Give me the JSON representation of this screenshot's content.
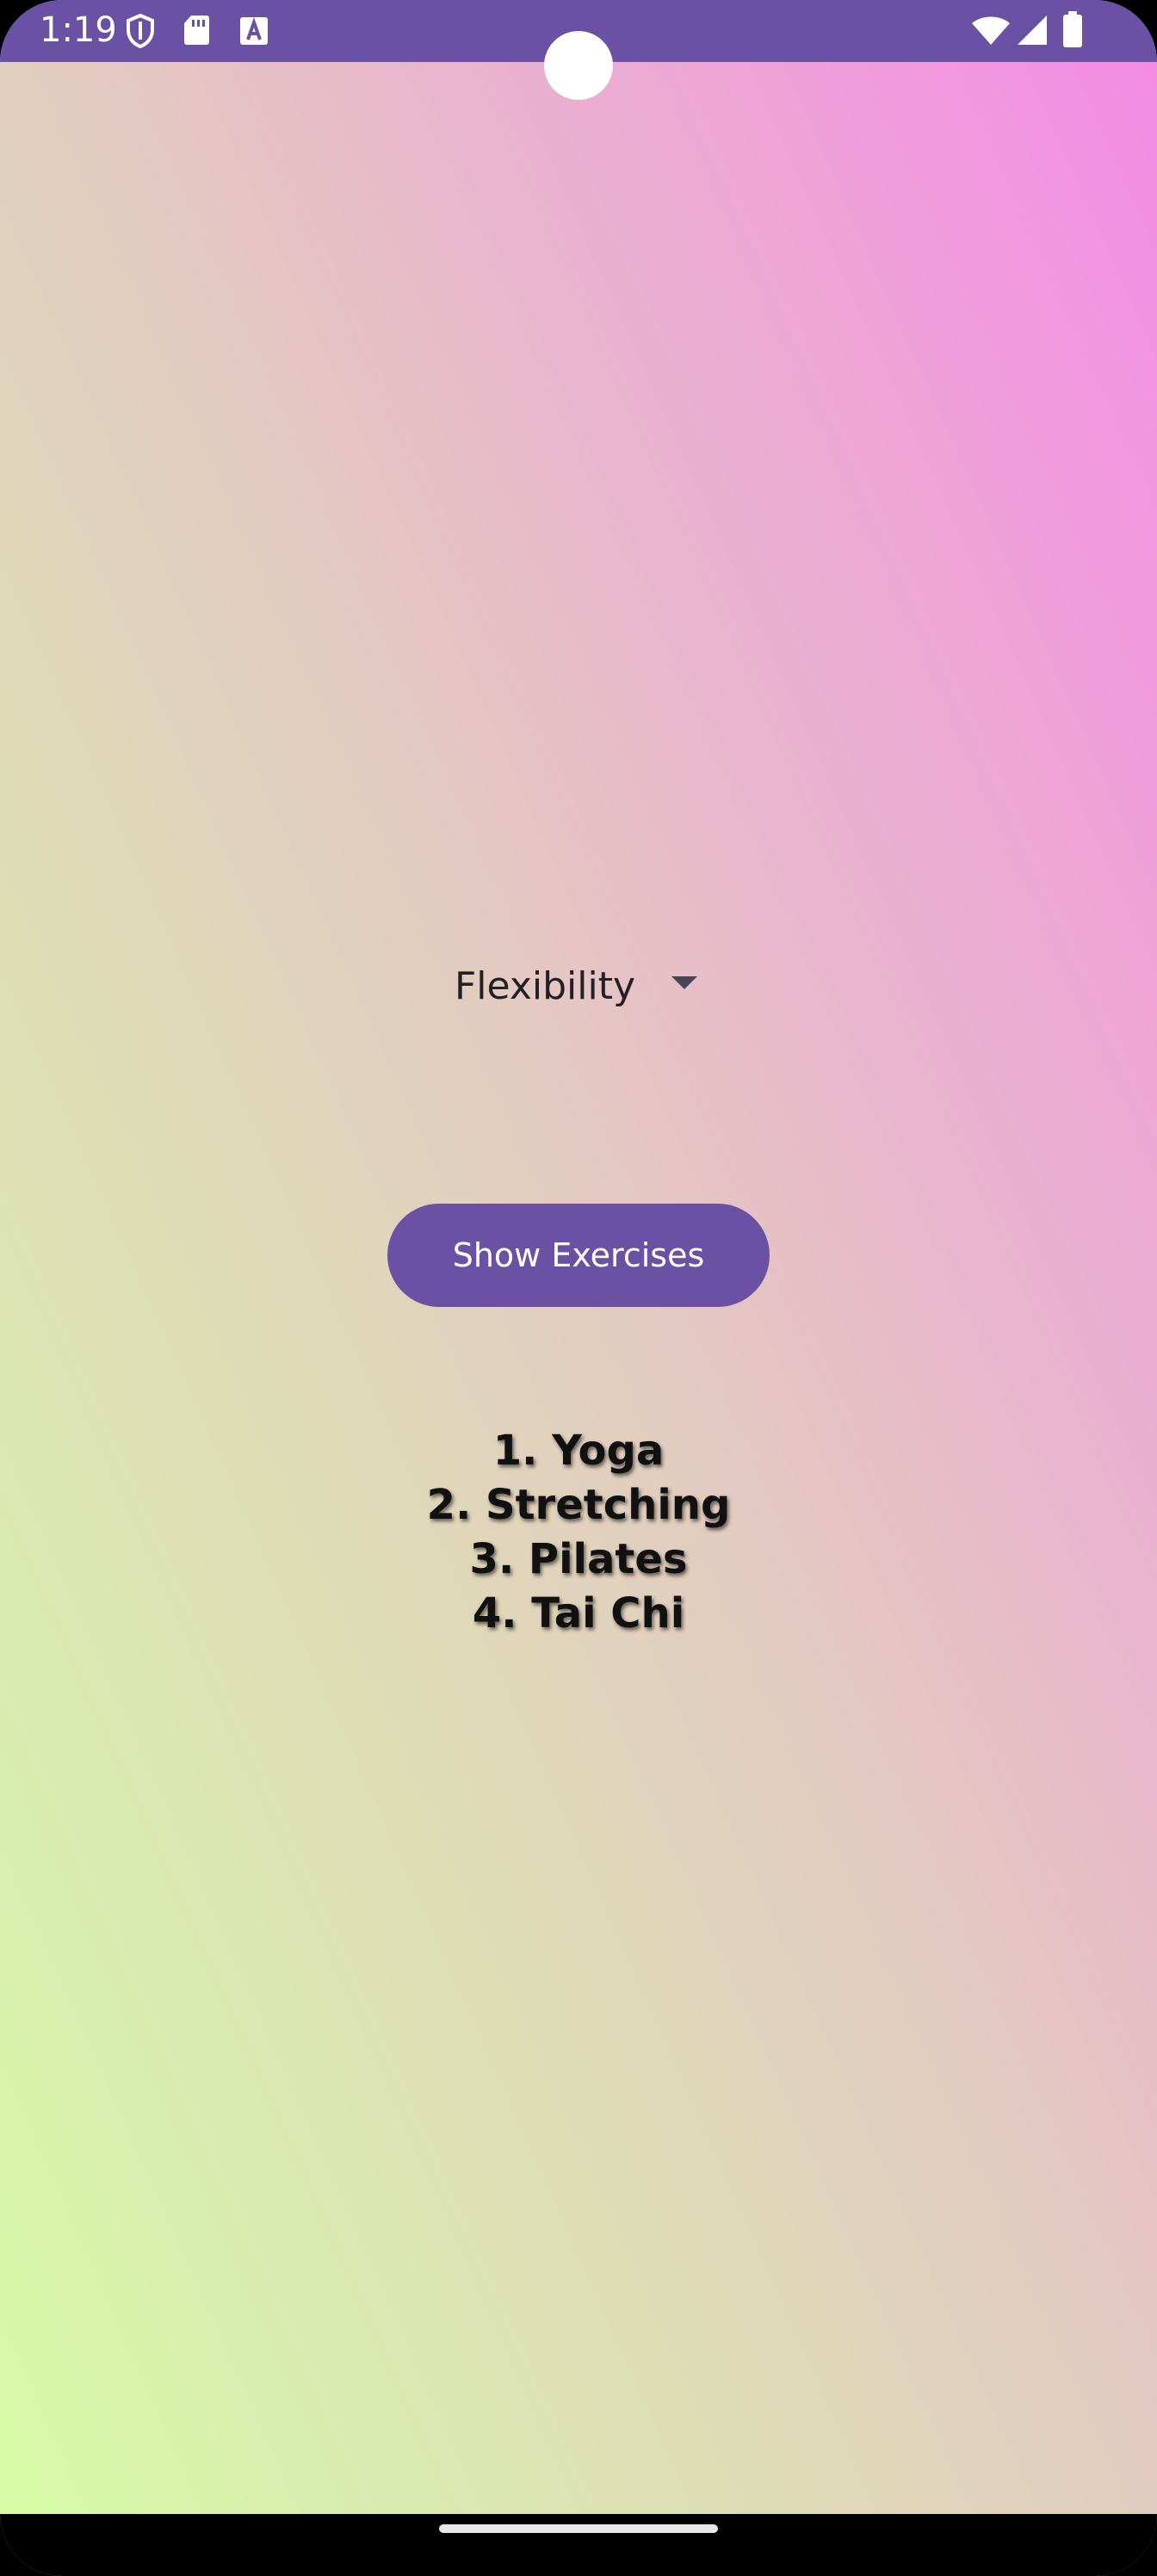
{
  "status_bar": {
    "time": "1:19",
    "color": "#6a51a3",
    "left_icons": [
      "shield-icon",
      "sd-card-icon",
      "font-a-icon"
    ],
    "right_icons": [
      "wifi-icon",
      "cellular-signal-icon",
      "battery-icon"
    ]
  },
  "category_dropdown": {
    "selected": "Flexibility"
  },
  "show_button": {
    "label": "Show Exercises",
    "color": "#6a51a3"
  },
  "exercises": [
    "1. Yoga",
    "2. Stretching",
    "3. Pilates",
    "4. Tai Chi"
  ],
  "colors": {
    "gradient_top_right": "#f58ae6",
    "gradient_bottom_left": "#d5fca6"
  }
}
